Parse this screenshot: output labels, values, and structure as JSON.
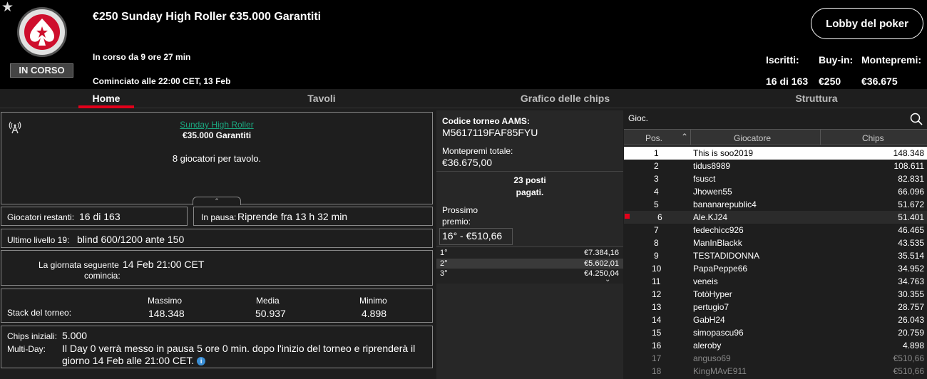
{
  "header": {
    "title": "€250 Sunday High Roller €35.000 Garantiti",
    "status": "IN CORSO",
    "running": "In corso da 9 ore 27 min",
    "started": "Cominciato alle 22:00 CET, 13 Feb",
    "lobby_button": "Lobby del poker",
    "entrants_label": "Iscritti:",
    "entrants_value": "16 di 163",
    "buyin_label": "Buy-in:",
    "buyin_value": "€250",
    "prize_label": "Montepremi:",
    "prize_value": "€36.675"
  },
  "tabs": [
    "Home",
    "Tavoli",
    "Grafico delle chips",
    "Struttura"
  ],
  "info": {
    "link": "Sunday High Roller",
    "guarantee": "€35.000 Garantiti",
    "players_per_table": "8 giocatori per tavolo.",
    "remaining_label": "Giocatori restanti:",
    "remaining_value": "16 di 163",
    "pause_label": "In pausa:",
    "pause_value": "Riprende fra 13 h 32 min",
    "level_label": "Ultimo livello 19:",
    "level_value": "blind 600/1200 ante 150",
    "nextday_label1": "La giornata seguente",
    "nextday_label2": "comincia:",
    "nextday_value": "14 Feb 21:00 CET",
    "stack_label": "Stack del torneo:",
    "max_label": "Massimo",
    "max_value": "148.348",
    "avg_label": "Media",
    "avg_value": "50.937",
    "min_label": "Minimo",
    "min_value": "4.898",
    "chips_label": "Chips iniziali:",
    "chips_value": "5.000",
    "multiday_label": "Multi-Day:",
    "multiday_value": "Il Day 0 verrà messo in pausa 5 ore 0 min. dopo l'inizio del torneo e riprenderà il giorno 14 Feb alle 21:00 CET."
  },
  "prize": {
    "code_label": "Codice torneo AAMS:",
    "code_value": "M5617119FAF85FYU",
    "total_label": "Montepremi totale:",
    "total_value": "€36.675,00",
    "paid1": "23 posti",
    "paid2": "pagati.",
    "next_label1": "Prossimo",
    "next_label2": "premio:",
    "next_value": "16° - €510,66",
    "places": [
      {
        "pos": "1°",
        "amount": "€7.384,16"
      },
      {
        "pos": "2°",
        "amount": "€5.602,01"
      },
      {
        "pos": "3°",
        "amount": "€4.250,04"
      }
    ]
  },
  "players": {
    "search_label": "Gioc.",
    "col_pos": "Pos.",
    "col_player": "Giocatore",
    "col_chips": "Chips",
    "rows": [
      {
        "pos": "1",
        "name": "This is soo2019",
        "chips": "148.348"
      },
      {
        "pos": "2",
        "name": "tidus8989",
        "chips": "108.611"
      },
      {
        "pos": "3",
        "name": "fsusct",
        "chips": "82.831"
      },
      {
        "pos": "4",
        "name": "Jhowen55",
        "chips": "66.096"
      },
      {
        "pos": "5",
        "name": "bananarepublic4",
        "chips": "51.672"
      },
      {
        "pos": "6",
        "name": "Ale.KJ24",
        "chips": "51.401"
      },
      {
        "pos": "7",
        "name": "fedechicc926",
        "chips": "46.465"
      },
      {
        "pos": "8",
        "name": "ManInBlackk",
        "chips": "43.535"
      },
      {
        "pos": "9",
        "name": "TESTADIDONNA",
        "chips": "35.514"
      },
      {
        "pos": "10",
        "name": "PapaPeppe66",
        "chips": "34.952"
      },
      {
        "pos": "11",
        "name": "veneis",
        "chips": "34.763"
      },
      {
        "pos": "12",
        "name": "TotòHyper",
        "chips": "30.355"
      },
      {
        "pos": "13",
        "name": "pertugio7",
        "chips": "28.757"
      },
      {
        "pos": "14",
        "name": "GabH24",
        "chips": "26.043"
      },
      {
        "pos": "15",
        "name": "simopascu96",
        "chips": "20.759"
      },
      {
        "pos": "16",
        "name": "aleroby",
        "chips": "4.898"
      },
      {
        "pos": "17",
        "name": "anguso69",
        "chips": "€510,66"
      },
      {
        "pos": "18",
        "name": "KingMAvE911",
        "chips": "€510,66"
      }
    ]
  },
  "colors": {
    "accent": "#e2001a",
    "link": "#1ba67f",
    "logo": "#ce0e2d"
  }
}
